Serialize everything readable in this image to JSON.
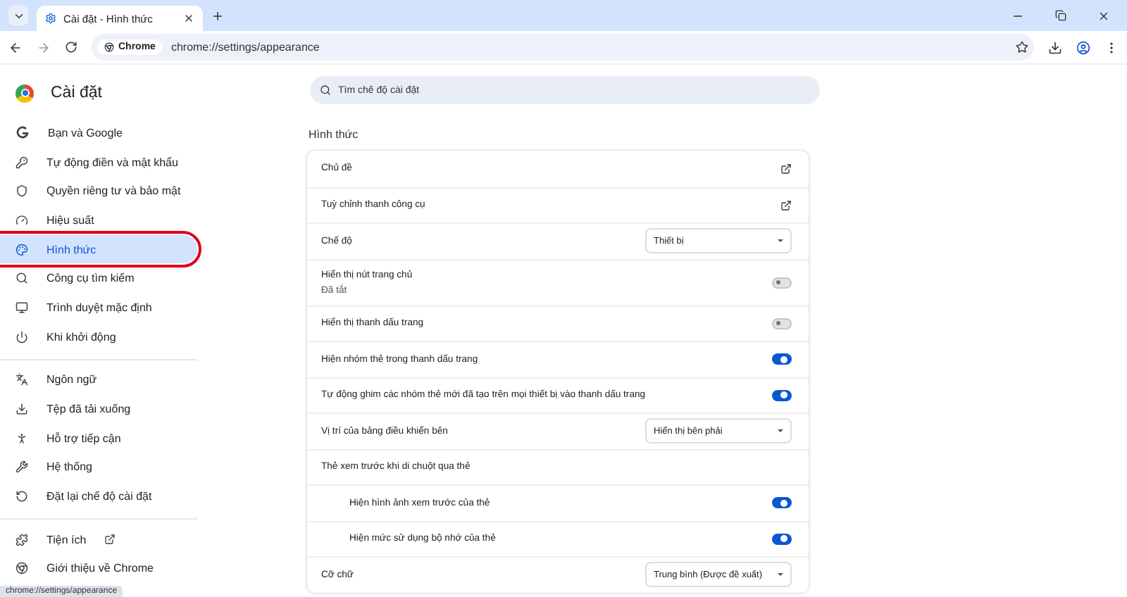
{
  "tab": {
    "title": "Cài đặt - Hình thức"
  },
  "toolbar": {
    "chip": "Chrome",
    "url": "chrome://settings/appearance"
  },
  "page": {
    "title": "Cài đặt",
    "search": {
      "placeholder": "Tìm chế độ cài đặt"
    }
  },
  "sidebar": {
    "sections": [
      [
        {
          "label": "Bạn và Google",
          "selected": false,
          "annotated": false,
          "external": false
        },
        {
          "label": "Tự động điền và mật khẩu",
          "selected": false,
          "annotated": false,
          "external": false
        },
        {
          "label": "Quyền riêng tư và bảo mật",
          "selected": false,
          "annotated": false,
          "external": false
        },
        {
          "label": "Hiệu suất",
          "selected": false,
          "annotated": false,
          "external": false
        },
        {
          "label": "Hình thức",
          "selected": true,
          "annotated": true,
          "external": false
        },
        {
          "label": "Công cụ tìm kiếm",
          "selected": false,
          "annotated": false,
          "external": false
        },
        {
          "label": "Trình duyệt mặc định",
          "selected": false,
          "annotated": false,
          "external": false
        },
        {
          "label": "Khi khởi động",
          "selected": false,
          "annotated": false,
          "external": false
        }
      ],
      [
        {
          "label": "Ngôn ngữ",
          "selected": false,
          "annotated": false,
          "external": false
        },
        {
          "label": "Tệp đã tải xuống",
          "selected": false,
          "annotated": false,
          "external": false
        },
        {
          "label": "Hỗ trợ tiếp cận",
          "selected": false,
          "annotated": false,
          "external": false
        },
        {
          "label": "Hệ thống",
          "selected": false,
          "annotated": false,
          "external": false
        },
        {
          "label": "Đặt lại chế độ cài đặt",
          "selected": false,
          "annotated": false,
          "external": false
        }
      ],
      [
        {
          "label": "Tiện ích",
          "selected": false,
          "annotated": false,
          "external": true
        },
        {
          "label": "Giới thiệu về Chrome",
          "selected": false,
          "annotated": false,
          "external": false
        }
      ]
    ]
  },
  "section": {
    "heading": "Hình thức",
    "rows": [
      {
        "kind": "link",
        "label": "Chủ đề"
      },
      {
        "kind": "link",
        "label": "Tuỳ chỉnh thanh công cụ"
      },
      {
        "kind": "select",
        "label": "Chế độ",
        "value": "Thiết bị"
      },
      {
        "kind": "toggle",
        "label": "Hiển thị nút trang chủ",
        "sublabel": "Đã tắt",
        "on": false,
        "indented": false
      },
      {
        "kind": "toggle",
        "label": "Hiển thị thanh dấu trang",
        "on": false,
        "indented": false
      },
      {
        "kind": "toggle",
        "label": "Hiện nhóm thẻ trong thanh dấu trang",
        "on": true,
        "indented": false
      },
      {
        "kind": "toggle",
        "label": "Tự động ghim các nhóm thẻ mới đã tạo trên mọi thiết bị vào thanh dấu trang",
        "on": true,
        "indented": false
      },
      {
        "kind": "select",
        "label": "Vị trí của bảng điều khiển bên",
        "value": "Hiển thị bên phải"
      },
      {
        "kind": "label",
        "label": "Thẻ xem trước khi di chuột qua thẻ"
      },
      {
        "kind": "toggle",
        "label": "Hiện hình ảnh xem trước của thẻ",
        "on": true,
        "indented": true
      },
      {
        "kind": "toggle",
        "label": "Hiện mức sử dụng bộ nhớ của thẻ",
        "on": true,
        "indented": true
      },
      {
        "kind": "select",
        "label": "Cỡ chữ",
        "value": "Trung bình (Được đề xuất)"
      }
    ]
  },
  "status_bar": {
    "text": "chrome://settings/appearance"
  }
}
